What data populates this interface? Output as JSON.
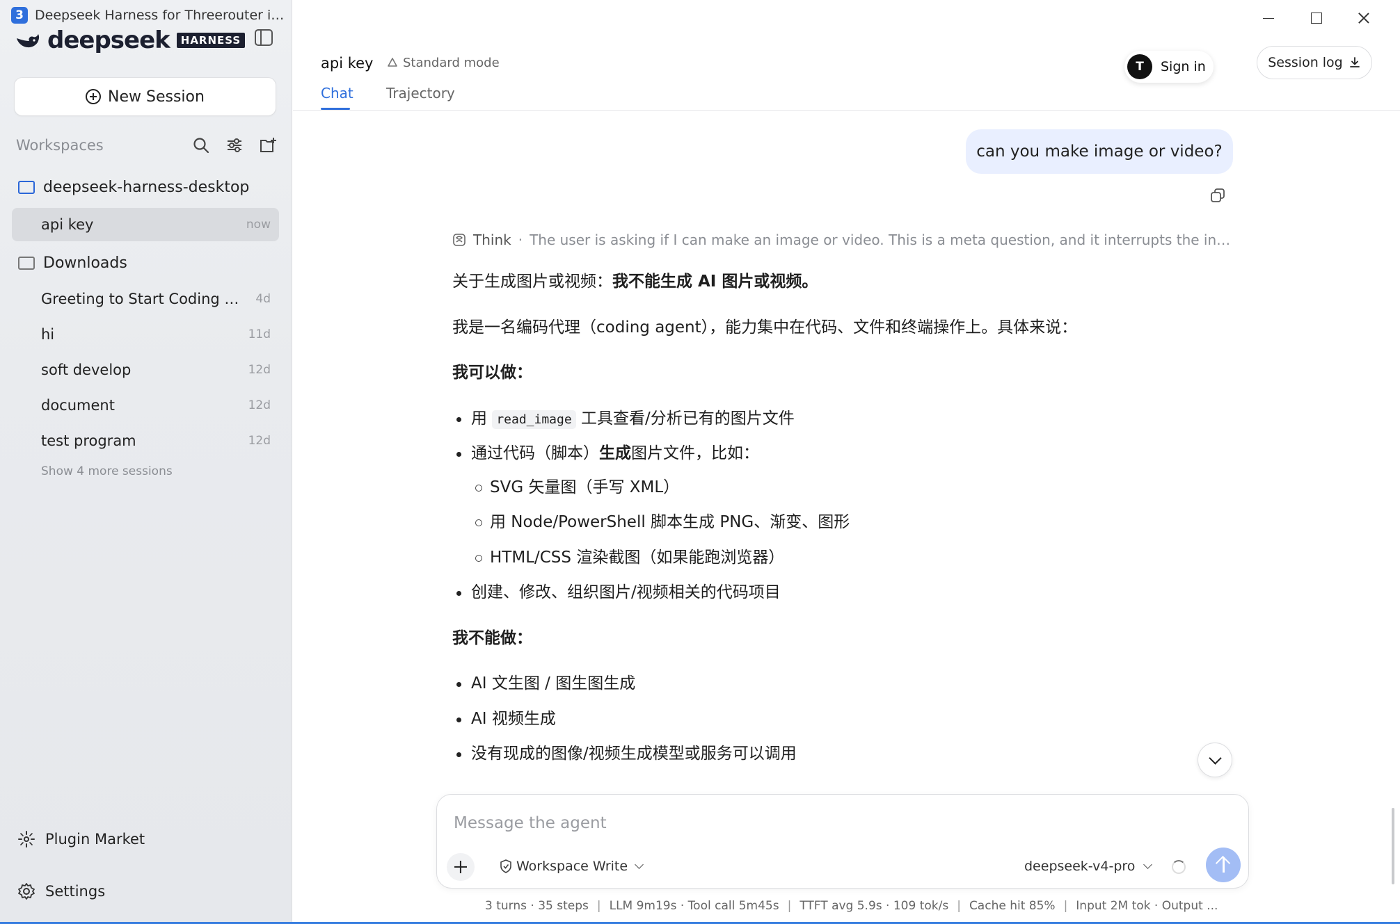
{
  "window": {
    "title": "Deepseek Harness for Threerouter image...",
    "app_icon_letter": "3"
  },
  "brand": {
    "name": "deepseek",
    "badge": "HARNESS"
  },
  "sidebar": {
    "new_session_label": "New Session",
    "workspaces_label": "Workspaces",
    "workspaces": [
      {
        "name": "deepseek-harness-desktop",
        "sessions": [
          {
            "title": "api key",
            "age": "now",
            "active": true
          }
        ]
      },
      {
        "name": "Downloads",
        "sessions": [
          {
            "title": "Greeting to Start Coding Sessi...",
            "age": "4d"
          },
          {
            "title": "hi",
            "age": "11d"
          },
          {
            "title": "soft develop",
            "age": "12d"
          },
          {
            "title": "document",
            "age": "12d"
          },
          {
            "title": "test program",
            "age": "12d"
          }
        ]
      }
    ],
    "show_more_label": "Show 4 more sessions",
    "plugin_market_label": "Plugin Market",
    "settings_label": "Settings"
  },
  "header": {
    "session_title": "api key",
    "mode": "Standard mode",
    "tabs": [
      {
        "label": "Chat",
        "active": true
      },
      {
        "label": "Trajectory",
        "active": false
      }
    ],
    "sign_in": {
      "avatar_letter": "T",
      "label": "Sign in"
    },
    "session_log_label": "Session log"
  },
  "chat": {
    "user_message": "can you make image or video?",
    "think": {
      "label": "Think",
      "summary": "The user is asking if I can make an image or video. This is a meta question, and it interrupts the in-progress ..."
    },
    "answer": {
      "intro_prefix": "关于生成图片或视频：",
      "intro_bold": "我不能生成 AI 图片或视频。",
      "description": "我是一名编码代理（coding agent），能力集中在代码、文件和终端操作上。具体来说：",
      "can_heading": "我可以做：",
      "can_item1_prefix": "用 ",
      "can_item1_code": "read_image",
      "can_item1_suffix": " 工具查看/分析已有的图片文件",
      "can_item2_prefix": "通过代码（脚本）",
      "can_item2_bold": "生成",
      "can_item2_suffix": "图片文件，比如：",
      "can_sub_items": [
        "SVG 矢量图（手写 XML）",
        "用 Node/PowerShell 脚本生成 PNG、渐变、图形",
        "HTML/CSS 渲染截图（如果能跑浏览器）"
      ],
      "can_item3": "创建、修改、组织图片/视频相关的代码项目",
      "cannot_heading": "我不能做：",
      "cannot_items": [
        "AI 文生图 / 图生图生成",
        "AI 视频生成",
        "没有现成的图像/视频生成模型或服务可以调用"
      ]
    }
  },
  "composer": {
    "placeholder": "Message the agent",
    "permission_label": "Workspace Write",
    "model_label": "deepseek-v4-pro"
  },
  "status_bar": {
    "turns": "3 turns · 35 steps",
    "timing": "LLM 9m19s · Tool call 5m45s",
    "ttft": "TTFT avg 5.9s · 109 tok/s",
    "cache": "Cache hit 85%",
    "tokens": "Input 2M tok · Output ..."
  },
  "colors": {
    "accent": "#2f6fdc",
    "user_bubble": "#e9efff",
    "send_button": "#a3bdf5"
  }
}
